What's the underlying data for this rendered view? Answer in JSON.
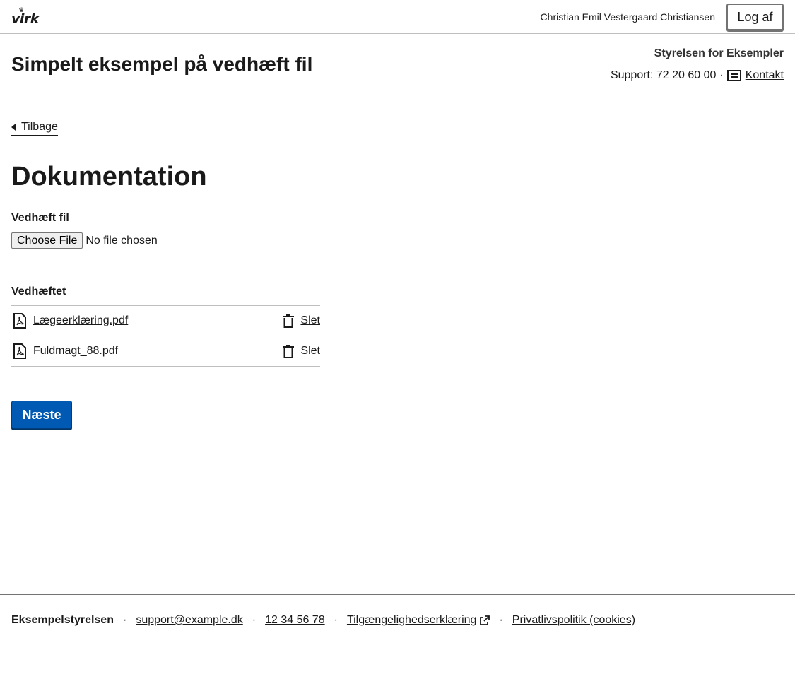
{
  "topbar": {
    "logo_text": "virk",
    "user_name": "Christian Emil Vestergaard Christiansen",
    "logout_label": "Log af"
  },
  "header": {
    "site_title": "Simpelt eksempel på vedhæft fil",
    "authority": "Styrelsen for Eksempler",
    "support_text": "Support: 72 20 60 00",
    "separator": "·",
    "contact_label": "Kontakt"
  },
  "main": {
    "back_label": "Tilbage",
    "heading": "Dokumentation",
    "file_input": {
      "label": "Vedhæft fil",
      "button_label": "Choose File",
      "status": "No file chosen"
    },
    "attached": {
      "label": "Vedhæftet",
      "delete_label": "Slet",
      "files": [
        {
          "name": "Lægeerklæring.pdf",
          "icon": "pdf-file-icon"
        },
        {
          "name": "Fuldmagt_88.pdf",
          "icon": "pdf-file-icon"
        }
      ]
    },
    "next_label": "Næste"
  },
  "footer": {
    "org": "Eksempelstyrelsen",
    "email": "support@example.dk",
    "phone": "12 34 56 78",
    "accessibility": "Tilgængelighedserklæring",
    "privacy": "Privatlivspolitik (cookies)",
    "separator": "·"
  },
  "colors": {
    "primary": "#0059b3",
    "text": "#1a1a1a",
    "border": "#737373"
  }
}
